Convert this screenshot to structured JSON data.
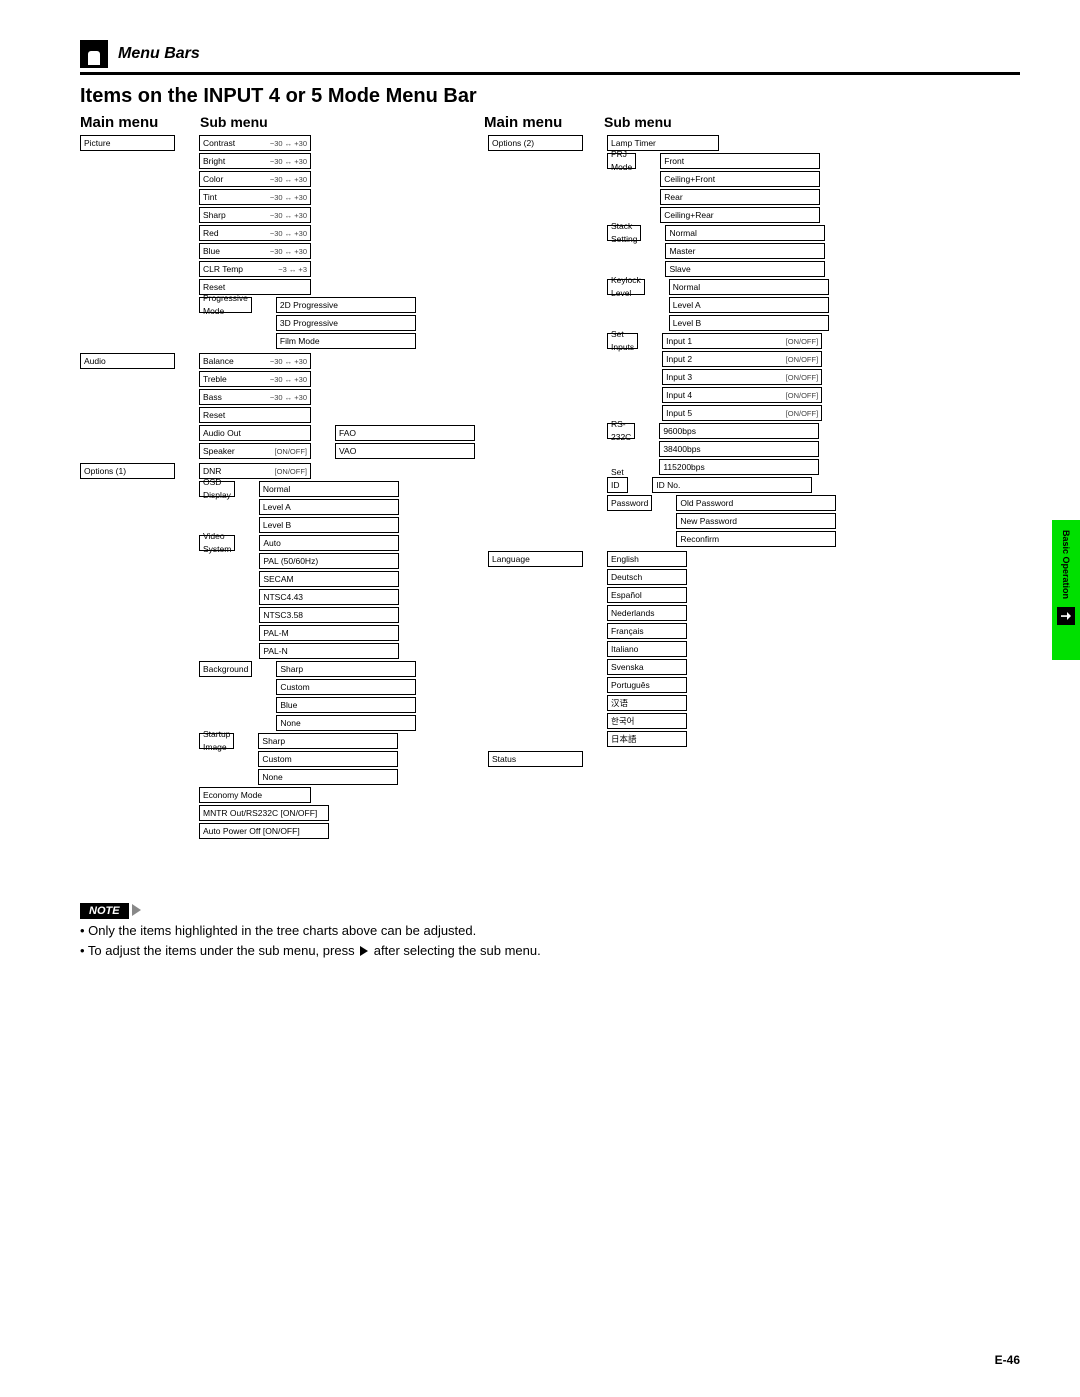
{
  "header": {
    "title": "Menu Bars"
  },
  "section_title": "Items on the INPUT 4 or 5 Mode Menu Bar",
  "col_headers": {
    "main": "Main menu",
    "sub": "Sub menu"
  },
  "side_tab": "Basic Operation",
  "footer": "E-46",
  "note": {
    "label": "NOTE",
    "lines": [
      "Only the items highlighted in the tree charts above can be adjusted.",
      "To adjust the items under the sub menu, press ▶ after selecting the sub menu."
    ]
  },
  "range": {
    "r30": "−30 ↔ +30",
    "r3": "−3 ↔ +3",
    "onoff": "[ON/OFF]"
  },
  "left": {
    "picture": {
      "title": "Picture",
      "items": [
        "Contrast",
        "Bright",
        "Color",
        "Tint",
        "Sharp",
        "Red",
        "Blue",
        "CLR Temp",
        "Reset",
        "Progressive Mode"
      ],
      "prog": [
        "2D Progressive",
        "3D Progressive",
        "Film Mode"
      ]
    },
    "audio": {
      "title": "Audio",
      "items": [
        "Balance",
        "Treble",
        "Bass",
        "Reset",
        "Audio Out",
        "Speaker"
      ],
      "audio_out": [
        "FAO",
        "VAO"
      ]
    },
    "options1": {
      "title": "Options (1)",
      "items": [
        "DNR",
        "OSD Display",
        "Video System",
        "Background",
        "Startup Image",
        "Economy Mode"
      ],
      "osd": [
        "Normal",
        "Level A",
        "Level B"
      ],
      "video": [
        "Auto",
        "PAL (50/60Hz)",
        "SECAM",
        "NTSC4.43",
        "NTSC3.58",
        "PAL-M",
        "PAL-N"
      ],
      "bg": [
        "Sharp",
        "Custom",
        "Blue",
        "None"
      ],
      "startup": [
        "Sharp",
        "Custom",
        "None"
      ],
      "economy": [
        "MNTR Out/RS232C [ON/OFF]",
        "Auto Power Off [ON/OFF]"
      ]
    }
  },
  "right": {
    "options2": {
      "title": "Options (2)",
      "items": [
        "Lamp Timer",
        "PRJ Mode",
        "Stack Setting",
        "Keylock Level",
        "Set Inputs",
        "RS-232C",
        "Set ID No.",
        "Password"
      ],
      "prj": [
        "Front",
        "Ceiling+Front",
        "Rear",
        "Ceiling+Rear"
      ],
      "stack": [
        "Normal",
        "Master",
        "Slave"
      ],
      "keylock": [
        "Normal",
        "Level A",
        "Level B"
      ],
      "inputs": [
        "Input 1",
        "Input 2",
        "Input 3",
        "Input 4",
        "Input 5"
      ],
      "rs232": [
        "9600bps",
        "38400bps",
        "115200bps"
      ],
      "setid": [
        "ID No."
      ],
      "password": [
        "Old Password",
        "New Password",
        "Reconfirm"
      ]
    },
    "language": {
      "title": "Language",
      "items": [
        "English",
        "Deutsch",
        "Español",
        "Nederlands",
        "Français",
        "Italiano",
        "Svenska",
        "Português",
        "汉语",
        "한국어",
        "日本語"
      ]
    },
    "status": {
      "title": "Status"
    }
  }
}
